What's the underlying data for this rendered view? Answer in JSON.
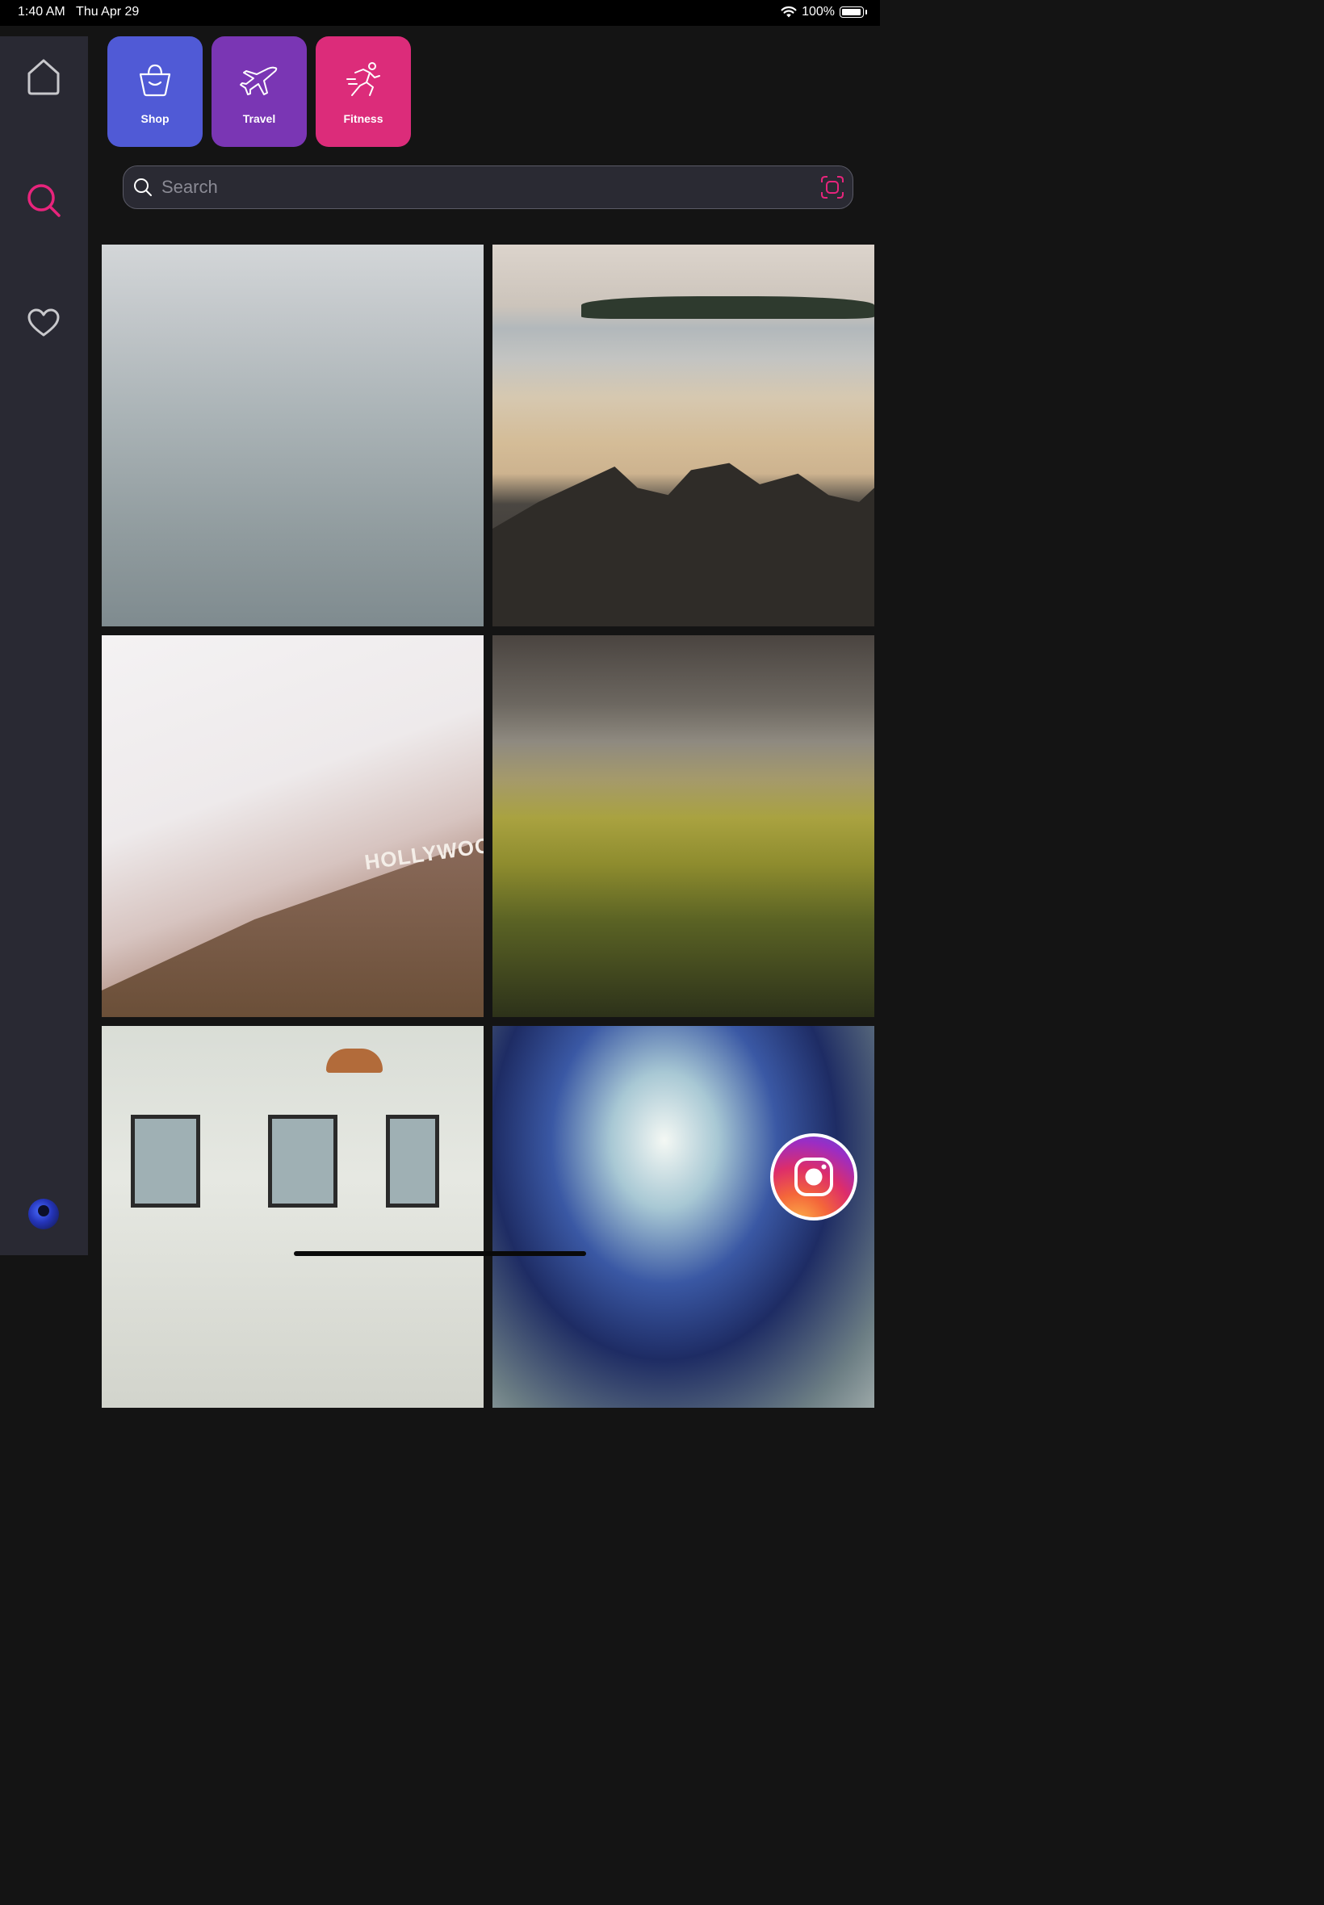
{
  "status_bar": {
    "time": "1:40 AM",
    "date": "Thu Apr 29",
    "battery_text": "100%",
    "battery_level": 1.0
  },
  "sidebar": {
    "items": [
      {
        "name": "home",
        "icon": "home-icon",
        "active": false
      },
      {
        "name": "search",
        "icon": "search-icon",
        "active": true
      },
      {
        "name": "favorites",
        "icon": "heart-icon",
        "active": false
      }
    ],
    "profile_icon": "avatar"
  },
  "categories": [
    {
      "label": "Shop",
      "icon": "shopping-bag-icon",
      "color": "#505ad6"
    },
    {
      "label": "Travel",
      "icon": "airplane-icon",
      "color": "#7a36b4"
    },
    {
      "label": "Fitness",
      "icon": "running-person-icon",
      "color": "#dc2c7a"
    }
  ],
  "search": {
    "placeholder": "Search",
    "value": ""
  },
  "grid_images": [
    {
      "subject": "snowy-forest"
    },
    {
      "subject": "beach-rocks"
    },
    {
      "subject": "hollywood-hills"
    },
    {
      "subject": "mountain-valley"
    },
    {
      "subject": "gallery-wall-lamp"
    },
    {
      "subject": "blurred-light"
    }
  ],
  "hollywood_sign_text": "HOLLYWOOD",
  "fab": {
    "icon": "camera-icon"
  },
  "colors": {
    "accent": "#e8247c",
    "background": "#141414",
    "sidebar": "#292933"
  }
}
